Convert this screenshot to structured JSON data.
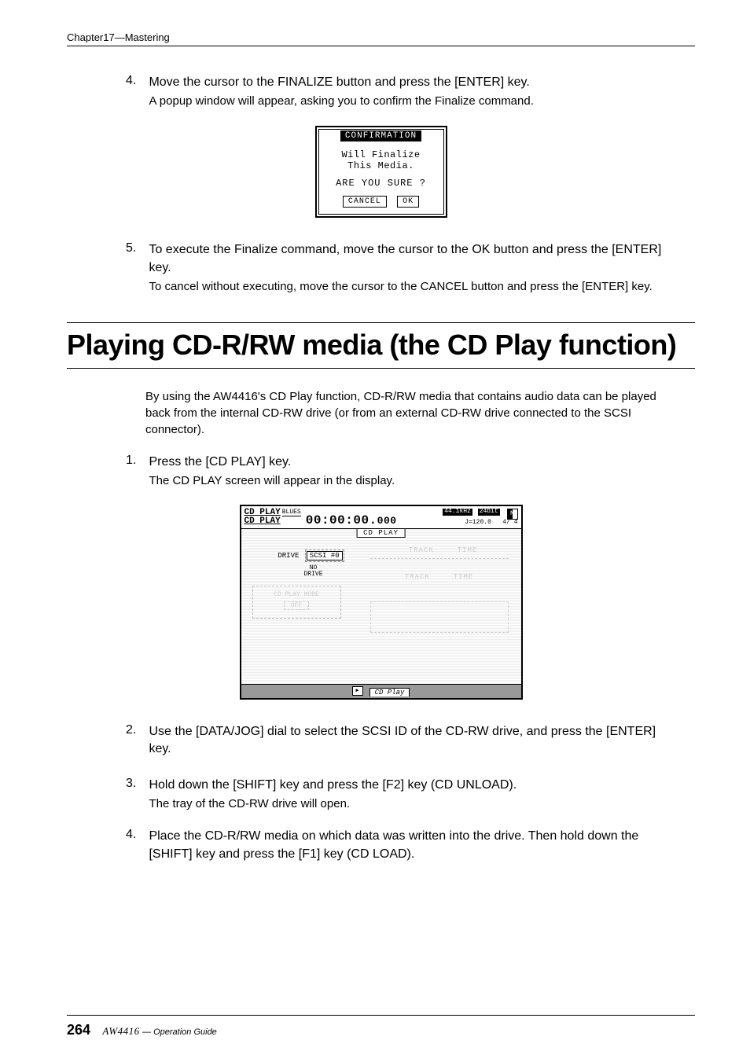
{
  "header": "Chapter17—Mastering",
  "steps_a": [
    {
      "num": "4.",
      "main": "Move the cursor to the FINALIZE button and press the [ENTER] key.",
      "sub": "A popup window will appear, asking you to confirm the Finalize command."
    },
    {
      "num": "5.",
      "main": "To execute the Finalize command, move the cursor to the OK button and press the [ENTER] key.",
      "sub": "To cancel without executing, move the cursor to the CANCEL button and press the [ENTER] key."
    }
  ],
  "dialog": {
    "title": "CONFIRMATION",
    "msg1": "Will Finalize",
    "msg2": "This Media.",
    "question": "ARE YOU SURE ?",
    "cancel": "CANCEL",
    "ok": "OK"
  },
  "section_title": "Playing CD-R/RW media (the CD Play function)",
  "intro": "By using the AW4416's CD Play function, CD-R/RW media that contains audio data can be played back from the internal CD-RW drive (or from an external CD-RW drive connected to the SCSI connector).",
  "steps_b": [
    {
      "num": "1.",
      "main": "Press the [CD PLAY] key.",
      "sub": "The CD PLAY screen will appear in the display."
    },
    {
      "num": "2.",
      "main": "Use the [DATA/JOG] dial to select the SCSI ID of the CD-RW drive, and press the [ENTER] key.",
      "sub": ""
    },
    {
      "num": "3.",
      "main": "Hold down the [SHIFT] key and press the [F2] key (CD UNLOAD).",
      "sub": "The tray of the CD-RW drive will open."
    },
    {
      "num": "4.",
      "main": "Place the CD-R/RW media on which data was written into the drive. Then hold down the [SHIFT] key and press the [F1] key (CD LOAD).",
      "sub": ""
    }
  ],
  "screen": {
    "top_label": "CD PLAY",
    "song": "BLUES",
    "tc": "00:00:00.",
    "tc_ms": "000",
    "rate": "44.1kHz",
    "bits": "24bit",
    "tempo": "J=120.0",
    "sig": "4/ 4",
    "tab": "CD PLAY",
    "track_hdr": "TRACK",
    "time_hdr": "TIME",
    "drive_label": "DRIVE",
    "scsi": "SCSI #0",
    "no_drive": "NO\nDRIVE",
    "mode_label": "CD PLAY MODE",
    "mode_value": "OFF",
    "footer_tab": "CD Play"
  },
  "footer": {
    "page": "264",
    "product": "AW4416",
    "guide": "— Operation Guide"
  }
}
